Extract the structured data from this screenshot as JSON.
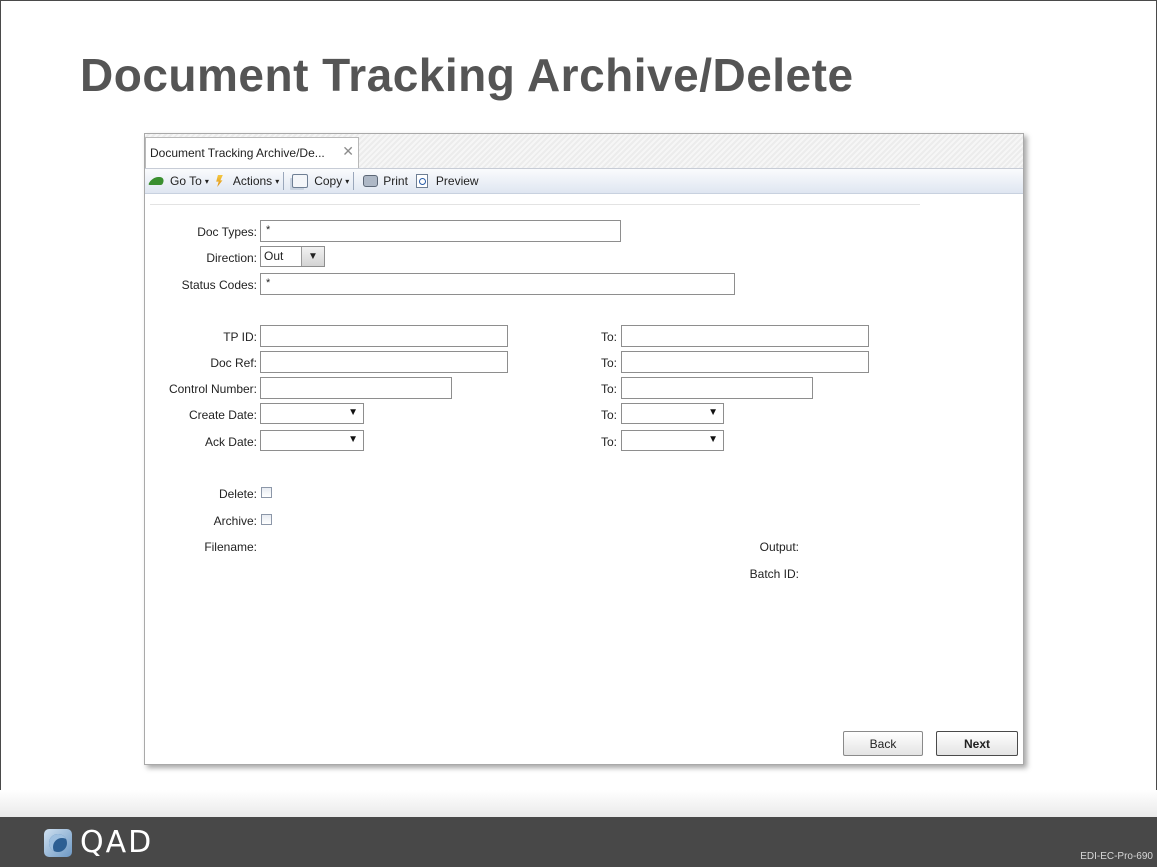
{
  "slide": {
    "title": "Document Tracking Archive/Delete",
    "logo_text": "QAD",
    "code": "EDI-EC-Pro-690"
  },
  "tab": {
    "label": "Document Tracking Archive/De...",
    "close_glyph": "✕"
  },
  "toolbar": {
    "goto_label": "Go To",
    "actions_label": "Actions",
    "copy_label": "Copy",
    "print_label": "Print",
    "preview_label": "Preview",
    "caret": "▾"
  },
  "form": {
    "doc_types": {
      "label": "Doc Types:",
      "value": "*"
    },
    "direction": {
      "label": "Direction:",
      "value": "Out"
    },
    "status_codes": {
      "label": "Status Codes:",
      "value": "*"
    },
    "tp_id": {
      "label": "TP ID:",
      "value": "",
      "to_label": "To:",
      "to_value": ""
    },
    "doc_ref": {
      "label": "Doc Ref:",
      "value": "",
      "to_label": "To:",
      "to_value": ""
    },
    "control_number": {
      "label": "Control Number:",
      "value": "",
      "to_label": "To:",
      "to_value": ""
    },
    "create_date": {
      "label": "Create Date:",
      "value": "",
      "to_label": "To:",
      "to_value": ""
    },
    "ack_date": {
      "label": "Ack Date:",
      "value": "",
      "to_label": "To:",
      "to_value": ""
    },
    "delete": {
      "label": "Delete:",
      "checked": false
    },
    "archive": {
      "label": "Archive:",
      "checked": false
    },
    "filename_label": "Filename:",
    "output_label": "Output:",
    "batch_id_label": "Batch ID:"
  },
  "buttons": {
    "back": "Back",
    "next": "Next"
  },
  "dropdown_glyph": "▼"
}
